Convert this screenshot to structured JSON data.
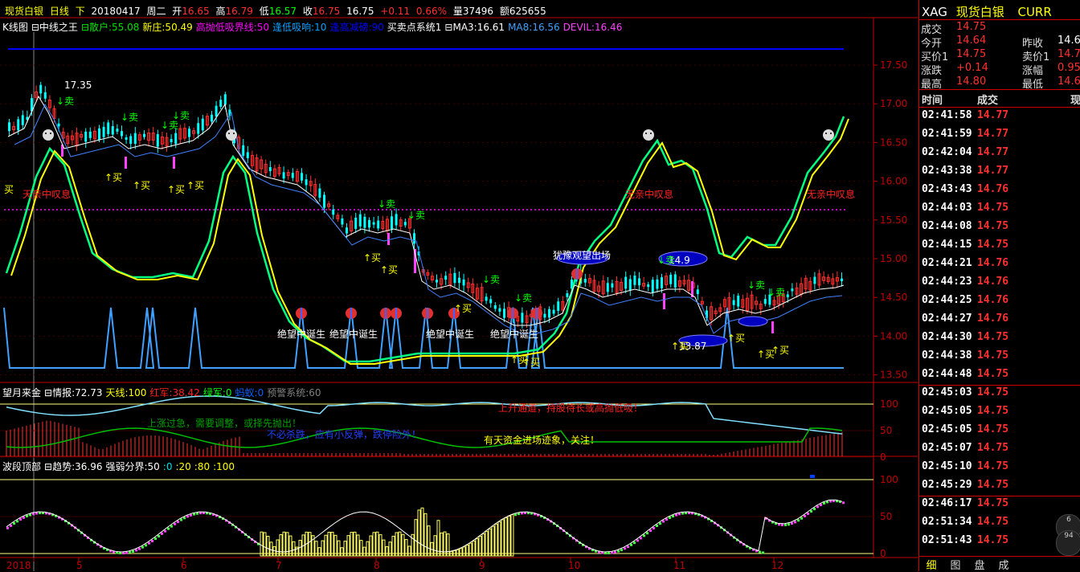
{
  "header": {
    "symbol_name": "现货白银",
    "period": "日线",
    "direction": "下",
    "date": "20180417",
    "weekday": "周二",
    "open_label": "开",
    "open": "16.65",
    "high_label": "高",
    "high": "16.79",
    "low_label": "低",
    "low": "16.57",
    "close_label": "收",
    "close": "16.75",
    "last": "16.75",
    "change": "+0.11",
    "change_pct": "0.66%",
    "volume_label": "量",
    "volume": "37496",
    "amount_label": "额",
    "amount": "625655"
  },
  "main_indicator": {
    "items": [
      {
        "text": "K线图",
        "color": "#ffffff"
      },
      {
        "text": "⊟中线之王",
        "color": "#ffffff"
      },
      {
        "text": "⊟散户:55.08",
        "color": "#00e000"
      },
      {
        "text": "新庄:50.49",
        "color": "#ffff00"
      },
      {
        "text": "高抛低吸界线:50",
        "color": "#ff00ff"
      },
      {
        "text": "逢低吸响:10",
        "color": "#00a0ff"
      },
      {
        "text": "逢高减磅:90",
        "color": "#0000ff"
      },
      {
        "text": "买卖点系统1",
        "color": "#ffffff"
      },
      {
        "text": "⊟MA3:16.61",
        "color": "#ffffff"
      },
      {
        "text": "MA8:16.56",
        "color": "#40a0ff"
      },
      {
        "text": "DEVIL:16.46",
        "color": "#ff40ff"
      }
    ],
    "y_ticks": [
      "17.50",
      "17.00",
      "16.50",
      "16.00",
      "15.50",
      "15.00",
      "14.50",
      "14.00",
      "13.50"
    ],
    "annotations": [
      {
        "text": "17.35",
        "color": "#ffffff"
      },
      {
        "text": "天亲中叹息",
        "color": "#ff2020"
      },
      {
        "text": "无亲中叹息",
        "color": "#ff2020"
      },
      {
        "text": "无亲中叹息",
        "color": "#ff2020"
      },
      {
        "text": "犹豫观望出场",
        "color": "#ffffff"
      },
      {
        "text": "14.9",
        "color": "#ffffff"
      },
      {
        "text": "13.87",
        "color": "#ffffff"
      },
      {
        "text": "绝望中诞生",
        "color": "#ffffff"
      },
      {
        "text": "↑买",
        "color": "#ffff00"
      },
      {
        "text": "↓卖",
        "color": "#00ff00"
      },
      {
        "text": "买",
        "color": "#ffff00"
      }
    ]
  },
  "sub1_indicator": {
    "items": [
      {
        "text": "望月来金",
        "color": "#ffffff"
      },
      {
        "text": "⊟情报:72.73",
        "color": "#ffffff"
      },
      {
        "text": "天线:100",
        "color": "#ffff00"
      },
      {
        "text": "红军:38.42",
        "color": "#ff2020"
      },
      {
        "text": "绿军:0",
        "color": "#00ff00"
      },
      {
        "text": "蚂蚁:0",
        "color": "#0060ff"
      },
      {
        "text": "预警系统:60",
        "color": "#808080"
      }
    ],
    "y_ticks": [
      "100",
      "50",
      "0"
    ],
    "notes": [
      {
        "text": "上升通道，持股待长或高抛低吸！",
        "color": "#ff2020"
      },
      {
        "text": "上涨过急，需要调整，或择先抛出！",
        "color": "#00a000"
      },
      {
        "text": "不必杀跌，应有小反弹，跌停险外！",
        "color": "#2040ff"
      },
      {
        "text": "有天资金进场迹象，关注！",
        "color": "#ffff00"
      }
    ]
  },
  "sub2_indicator": {
    "items": [
      {
        "text": "波段顶部",
        "color": "#ffffff"
      },
      {
        "text": "⊟趋势:36.96",
        "color": "#ffffff"
      },
      {
        "text": "强弱分界:50",
        "color": "#ffffff"
      },
      {
        "text": ":0",
        "color": "#00e0e0"
      },
      {
        "text": ":20",
        "color": "#ffff00"
      },
      {
        "text": ":80",
        "color": "#ffff00"
      },
      {
        "text": ":100",
        "color": "#ffff00"
      }
    ],
    "y_ticks": [
      "100",
      "50",
      "0"
    ]
  },
  "x_axis": [
    "2018",
    "5",
    "6",
    "7",
    "8",
    "9",
    "10",
    "11",
    "12"
  ],
  "quote": {
    "code": "XAG",
    "name": "现货白银",
    "suffix": "CURR",
    "last_label": "成交",
    "last": "14.75",
    "open_label": "今开",
    "open": "14.64",
    "prev_label": "昨收",
    "prev": "14.6",
    "bid_label": "买价1",
    "bid": "14.75",
    "ask_label": "卖价1",
    "ask": "14.7",
    "chg_label": "涨跌",
    "chg": "+0.14",
    "chgpct_label": "涨幅",
    "chgpct": "0.95",
    "high_label": "最高",
    "high": "14.80",
    "low_label": "最低",
    "low": "14.6",
    "col_time": "时间",
    "col_price": "成交",
    "col_now": "现",
    "ticks": [
      {
        "t": "02:41:58",
        "p": "14.77"
      },
      {
        "t": "02:41:59",
        "p": "14.77"
      },
      {
        "t": "02:42:04",
        "p": "14.77"
      },
      {
        "t": "02:43:38",
        "p": "14.77"
      },
      {
        "t": "02:43:43",
        "p": "14.76"
      },
      {
        "t": "02:44:03",
        "p": "14.75"
      },
      {
        "t": "02:44:08",
        "p": "14.75"
      },
      {
        "t": "02:44:15",
        "p": "14.75"
      },
      {
        "t": "02:44:21",
        "p": "14.76"
      },
      {
        "t": "02:44:23",
        "p": "14.76"
      },
      {
        "t": "02:44:25",
        "p": "14.76"
      },
      {
        "t": "02:44:27",
        "p": "14.76"
      },
      {
        "t": "02:44:30",
        "p": "14.75"
      },
      {
        "t": "02:44:38",
        "p": "14.75"
      },
      {
        "t": "02:44:48",
        "p": "14.75"
      },
      {
        "t": "02:45:03",
        "p": "14.75"
      },
      {
        "t": "02:45:05",
        "p": "14.75"
      },
      {
        "t": "02:45:05",
        "p": "14.75"
      },
      {
        "t": "02:45:07",
        "p": "14.75"
      },
      {
        "t": "02:45:10",
        "p": "14.75"
      },
      {
        "t": "02:45:29",
        "p": "14.75"
      },
      {
        "t": "02:46:17",
        "p": "14.75"
      },
      {
        "t": "02:51:34",
        "p": "14.75"
      },
      {
        "t": "02:51:43",
        "p": "14.75"
      }
    ],
    "side_buttons": [
      {
        "label": "6"
      },
      {
        "label": "94"
      }
    ],
    "tabs": [
      "细",
      "图",
      "盘",
      "成"
    ]
  },
  "colors": {
    "up": "#ff3030",
    "down": "#00ffff",
    "grid": "#8b0000",
    "axis": "#c00000"
  }
}
